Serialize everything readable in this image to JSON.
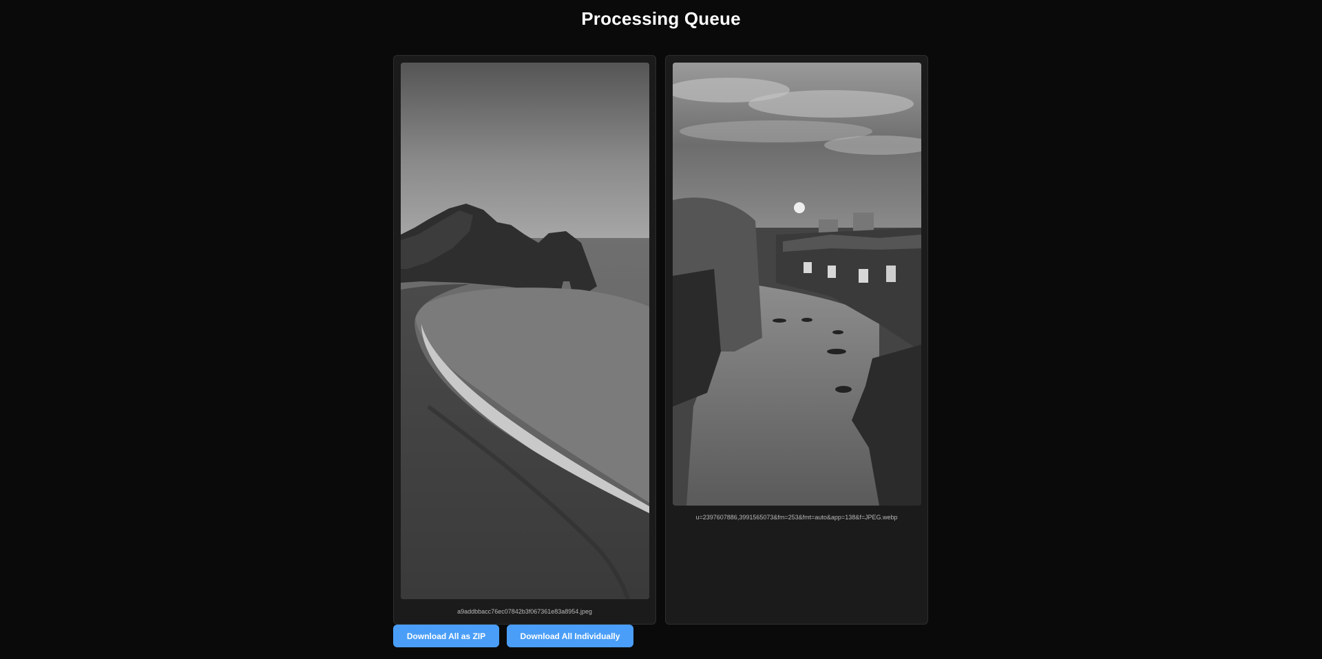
{
  "header": {
    "title": "Processing Queue"
  },
  "queue": {
    "items": [
      {
        "filename": "a9addbbacc76ec07842b3f067361e83a8954.jpeg",
        "image": "coastal-arch-grayscale"
      },
      {
        "filename": "u=2397607886,3991565073&fm=253&fmt=auto&app=138&f=JPEG.webp",
        "image": "canal-town-grayscale"
      }
    ]
  },
  "actions": {
    "zip_label": "Download All as ZIP",
    "individual_label": "Download All Individually"
  },
  "colors": {
    "background": "#0a0a0a",
    "card": "#1b1b1b",
    "accent": "#4a9ef8"
  }
}
